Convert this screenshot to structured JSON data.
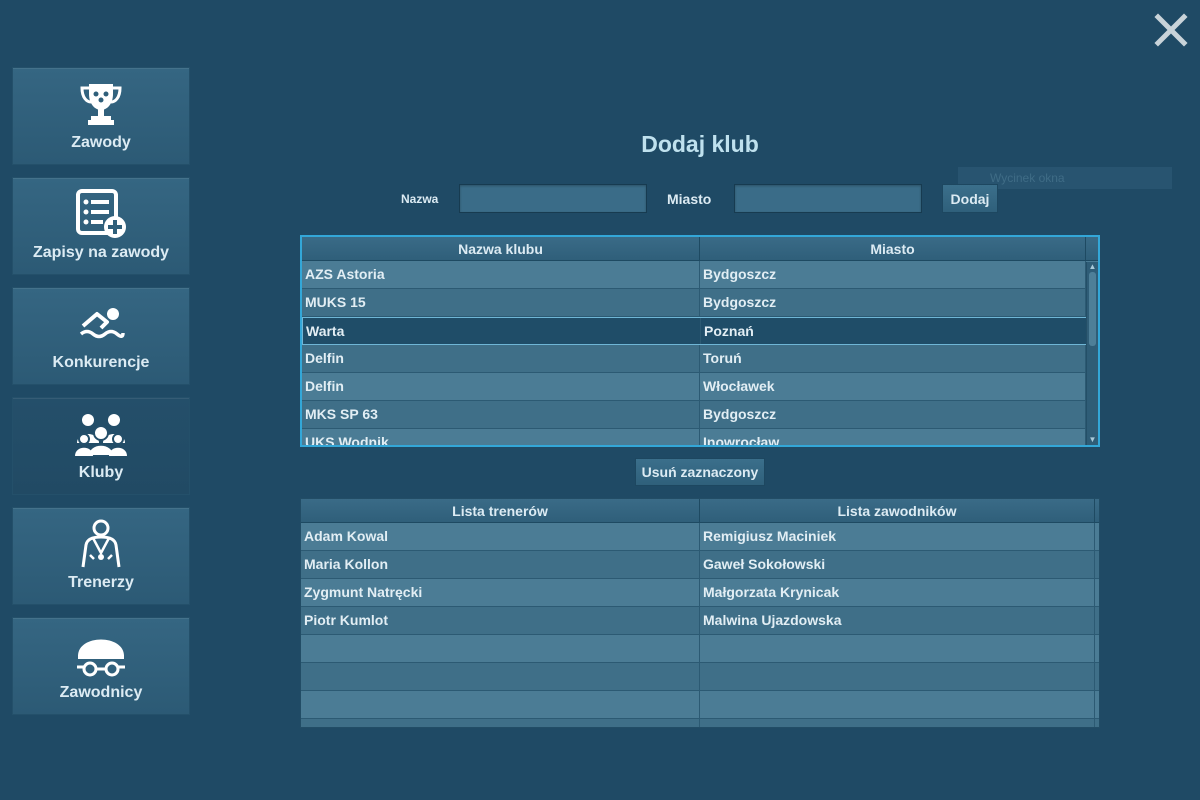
{
  "sidebar": {
    "items": [
      {
        "label": "Zawody",
        "icon": "trophy-icon"
      },
      {
        "label": "Zapisy na zawody",
        "icon": "list-add-icon"
      },
      {
        "label": "Konkurencje",
        "icon": "swimmer-icon"
      },
      {
        "label": "Kluby",
        "icon": "group-icon",
        "active": true
      },
      {
        "label": "Trenerzy",
        "icon": "coach-icon"
      },
      {
        "label": "Zawodnicy",
        "icon": "swim-cap-goggles-icon"
      }
    ]
  },
  "page": {
    "title": "Dodaj klub"
  },
  "overlay": {
    "watermark": "Wycinek okna"
  },
  "form": {
    "nazwa_label": "Nazwa",
    "nazwa_value": "",
    "miasto_label": "Miasto",
    "miasto_value": "",
    "add_label": "Dodaj"
  },
  "clubs_table": {
    "headers": [
      "Nazwa klubu",
      "Miasto"
    ],
    "rows": [
      [
        "AZS Astoria",
        "Bydgoszcz"
      ],
      [
        "MUKS 15",
        "Bydgoszcz"
      ],
      [
        "Warta",
        "Poznań"
      ],
      [
        "Delfin",
        "Toruń"
      ],
      [
        "Delfin",
        "Włocławek"
      ],
      [
        "MKS SP 63",
        "Bydgoszcz"
      ],
      [
        "UKS Wodnik",
        "Inowrocław"
      ]
    ],
    "selected_row": 2
  },
  "delete_label": "Usuń zaznaczony",
  "lists_table": {
    "headers": [
      "Lista trenerów",
      "Lista zawodników"
    ],
    "rows": [
      [
        "Adam Kowal",
        "Remigiusz Maciniek"
      ],
      [
        "Maria Kollon",
        "Gaweł Sokołowski"
      ],
      [
        "Zygmunt Natręcki",
        "Małgorzata Krynicak"
      ],
      [
        "Piotr Kumlot",
        "Malwina Ujazdowska"
      ],
      [
        "",
        ""
      ],
      [
        "",
        ""
      ],
      [
        "",
        ""
      ],
      [
        "",
        ""
      ]
    ]
  },
  "colors": {
    "background": "#1f4a65",
    "title": "#bfe1ee",
    "selection_border": "#33a7d8"
  }
}
